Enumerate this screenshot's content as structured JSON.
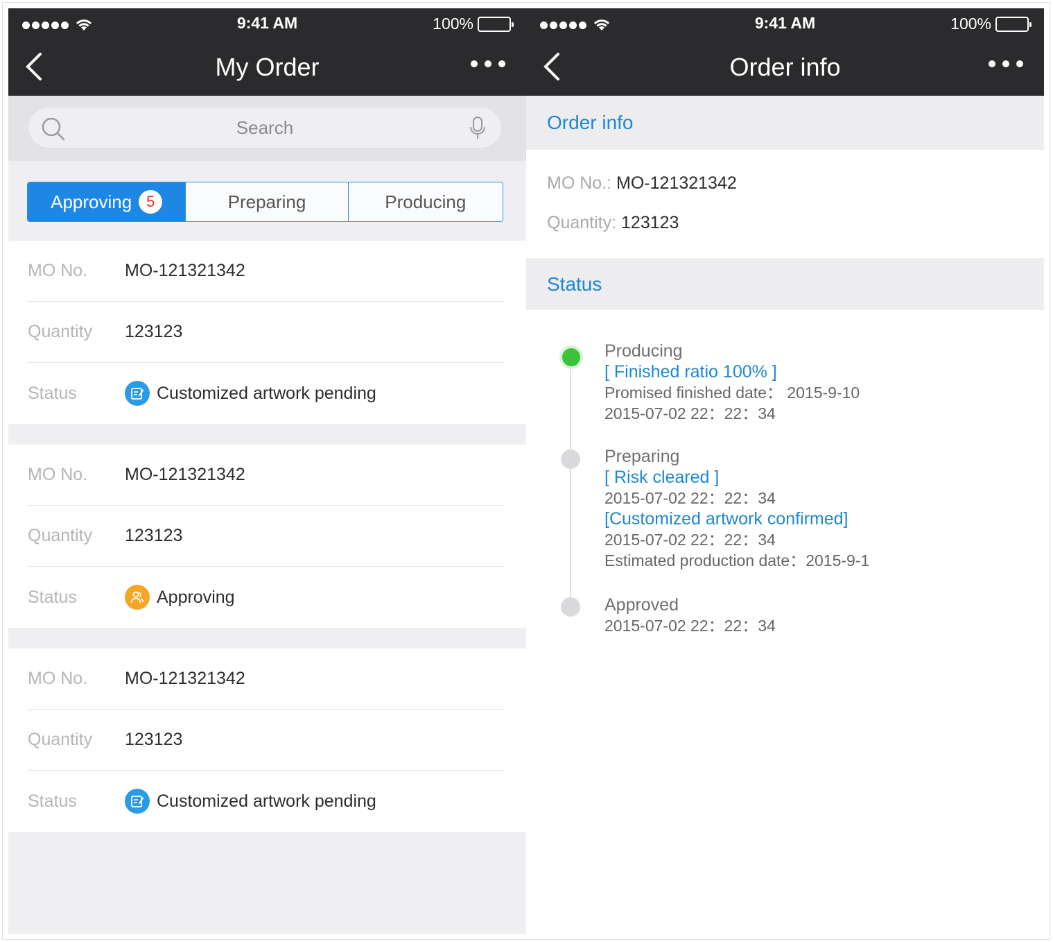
{
  "status_bar": {
    "time": "9:41 AM",
    "battery": "100%"
  },
  "left": {
    "nav_title": "My Order",
    "search_placeholder": "Search",
    "tabs": [
      {
        "label": "Approving",
        "badge": "5"
      },
      {
        "label": "Preparing"
      },
      {
        "label": "Producing"
      }
    ],
    "orders": [
      {
        "mo_label": "MO No.",
        "mo": "MO-121321342",
        "qty_label": "Quantity",
        "qty": "123123",
        "status_label": "Status",
        "status": "Customized artwork pending",
        "status_icon": "edit-icon",
        "status_color": "#2a9be6"
      },
      {
        "mo_label": "MO No.",
        "mo": "MO-121321342",
        "qty_label": "Quantity",
        "qty": "123123",
        "status_label": "Status",
        "status": "Approving",
        "status_icon": "users-icon",
        "status_color": "#f5a623"
      },
      {
        "mo_label": "MO No.",
        "mo": "MO-121321342",
        "qty_label": "Quantity",
        "qty": "123123",
        "status_label": "Status",
        "status": "Customized artwork pending",
        "status_icon": "edit-icon",
        "status_color": "#2a9be6"
      }
    ]
  },
  "right": {
    "nav_title": "Order info",
    "section_info": "Order info",
    "mo_label": "MO No.:",
    "mo": "MO-121321342",
    "qty_label": "Quantity:",
    "qty": "123123",
    "section_status": "Status",
    "timeline": [
      {
        "stage": "Producing",
        "highlight": "[ Finished ratio 100% ]",
        "line1": "Promised finished date：  2015-9-10",
        "line2": "2015-07-02   22：22：34"
      },
      {
        "stage": "Preparing",
        "highlight": "[ Risk cleared ]",
        "line1": "2015-07-02   22：22：34",
        "highlight2": "[Customized artwork confirmed]",
        "line2": "2015-07-02 22：22：34",
        "line3": "Estimated production date：2015-9-1"
      },
      {
        "stage": "Approved",
        "line1": "2015-07-02   22：22：34"
      }
    ]
  },
  "colors": {
    "nav_bg": "#2b2b2d",
    "accent": "#1e87e4",
    "link": "#1e87d2",
    "active_dot": "#3ac23a",
    "badge_text": "#e0322b"
  }
}
